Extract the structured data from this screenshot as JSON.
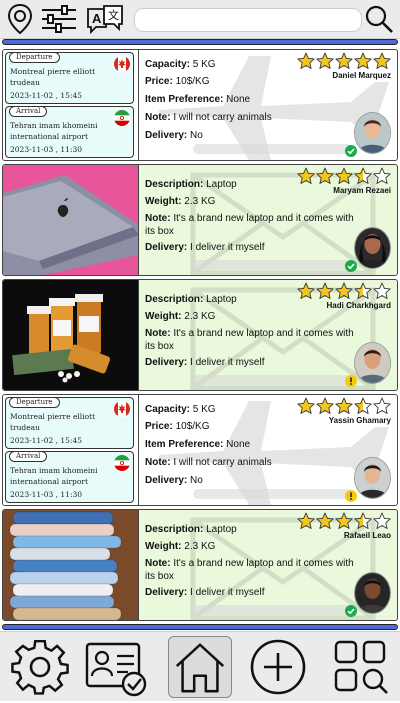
{
  "topbar": {
    "icons": [
      "map-pin-icon",
      "sliders-icon",
      "translate-icon",
      "search-icon"
    ],
    "search_placeholder": ""
  },
  "cards": [
    {
      "kind": "route",
      "departure_tag": "Departure",
      "departure_place": "Montreal pierre elliott trudeau",
      "departure_date": "2023-11-02 , 15:45",
      "departure_flag": "canada-flag-icon",
      "arrival_tag": "Arrival",
      "arrival_place": "Tehran imam khomeini international airport",
      "arrival_date": "2023-11-03 , 11:30",
      "arrival_flag": "iran-flag-icon",
      "rows": [
        {
          "label": "Capacity:",
          "value": "5 KG"
        },
        {
          "label": "Price:",
          "value": "10$/KG"
        },
        {
          "label": "Item Preference:",
          "value": "None"
        },
        {
          "label": "Note:",
          "value": "I will not carry animals"
        },
        {
          "label": "Delivery:",
          "value": "No"
        }
      ],
      "rating": 5,
      "user": "Daniel Marquez",
      "status": "verified",
      "watermark": "airplane-icon"
    },
    {
      "kind": "item",
      "image": "laptop-photo",
      "rows": [
        {
          "label": "Description:",
          "value": "Laptop"
        },
        {
          "label": "Weight:",
          "value": "2.3 KG"
        },
        {
          "label": "Note:",
          "value": "It's a brand new laptop and it comes with its box"
        },
        {
          "label": "Delivery:",
          "value": "I deliver it myself"
        }
      ],
      "rating": 3.5,
      "user": "Maryam Rezaei",
      "status": "verified",
      "watermark": "envelope-icon"
    },
    {
      "kind": "item",
      "image": "medicine-bottles-photo",
      "rows": [
        {
          "label": "Description:",
          "value": "Laptop"
        },
        {
          "label": "Weight:",
          "value": "2.3 KG"
        },
        {
          "label": "Note:",
          "value": "It's a brand new laptop and it comes with its box"
        },
        {
          "label": "Delivery:",
          "value": "I deliver it myself"
        }
      ],
      "rating": 3.5,
      "user": "Hadi Charkhgard",
      "status": "warning",
      "watermark": "envelope-icon"
    },
    {
      "kind": "route",
      "departure_tag": "Departure",
      "departure_place": "Montreal pierre elliott trudeau",
      "departure_date": "2023-11-02 , 15:45",
      "departure_flag": "canada-flag-icon",
      "arrival_tag": "Arrival",
      "arrival_place": "Tehran imam khomeini international airport",
      "arrival_date": "2023-11-03 , 11:30",
      "arrival_flag": "iran-flag-icon",
      "rows": [
        {
          "label": "Capacity:",
          "value": "5 KG"
        },
        {
          "label": "Price:",
          "value": "10$/KG"
        },
        {
          "label": "Item Preference:",
          "value": "None"
        },
        {
          "label": "Note:",
          "value": "I will not carry animals"
        },
        {
          "label": "Delivery:",
          "value": "No"
        }
      ],
      "rating": 3.5,
      "user": "Yassin Ghamary",
      "status": "warning",
      "watermark": "airplane-icon"
    },
    {
      "kind": "item",
      "image": "folded-clothes-photo",
      "rows": [
        {
          "label": "Description:",
          "value": "Laptop"
        },
        {
          "label": "Weight:",
          "value": "2.3 KG"
        },
        {
          "label": "Note:",
          "value": "It's a brand new laptop and it comes with its box"
        },
        {
          "label": "Delivery:",
          "value": "I deliver it myself"
        }
      ],
      "rating": 3.5,
      "user": "Rafaeil Leao",
      "status": "verified",
      "watermark": "envelope-icon"
    }
  ],
  "bottom_nav": [
    "settings-gear-icon",
    "profile-card-check-icon",
    "home-icon",
    "add-plus-icon",
    "search-grid-icon"
  ],
  "colors": {
    "accent_blue": "#4e6ad9",
    "card_bg": "#eaf8dc",
    "route_bg": "#e8fbfb",
    "star": "#f2c71d",
    "verified": "#1aab4a",
    "warning": "#f2cc0c"
  }
}
